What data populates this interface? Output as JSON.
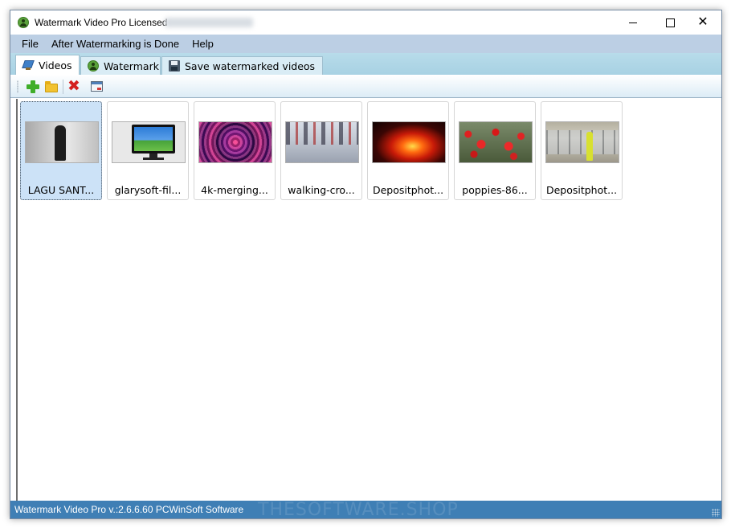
{
  "window": {
    "title": "Watermark Video Pro Licensed"
  },
  "menu": {
    "items": [
      {
        "label": "File"
      },
      {
        "label": "After Watermarking is Done"
      },
      {
        "label": "Help"
      }
    ]
  },
  "tabs": [
    {
      "label": "Videos",
      "icon": "pin-icon",
      "active": true
    },
    {
      "label": "Watermark",
      "icon": "person-icon",
      "active": false
    },
    {
      "label": "Save watermarked videos",
      "icon": "floppy-icon",
      "active": false
    }
  ],
  "toolbar": {
    "buttons": [
      {
        "icon": "add-icon"
      },
      {
        "icon": "folder-icon"
      },
      {
        "icon": "delete-icon"
      },
      {
        "icon": "window-icon"
      }
    ]
  },
  "videos": [
    {
      "caption": "LAGU SANT...",
      "selected": true
    },
    {
      "caption": "glarysoft-fil...",
      "selected": false
    },
    {
      "caption": "4k-merging...",
      "selected": false
    },
    {
      "caption": "walking-cro...",
      "selected": false
    },
    {
      "caption": "Depositphot...",
      "selected": false
    },
    {
      "caption": "poppies-86...",
      "selected": false
    },
    {
      "caption": "Depositphot...",
      "selected": false
    }
  ],
  "status": {
    "text": "Watermark Video Pro v.:2.6.6.60 PCWinSoft Software",
    "overlay": "THESOFTWARE.SHOP"
  },
  "colors": {
    "menubar": "#bccfe4",
    "tabstrip": "#a7d1e3",
    "statusbar": "#3f7fb5",
    "selection": "#cce2f7"
  }
}
